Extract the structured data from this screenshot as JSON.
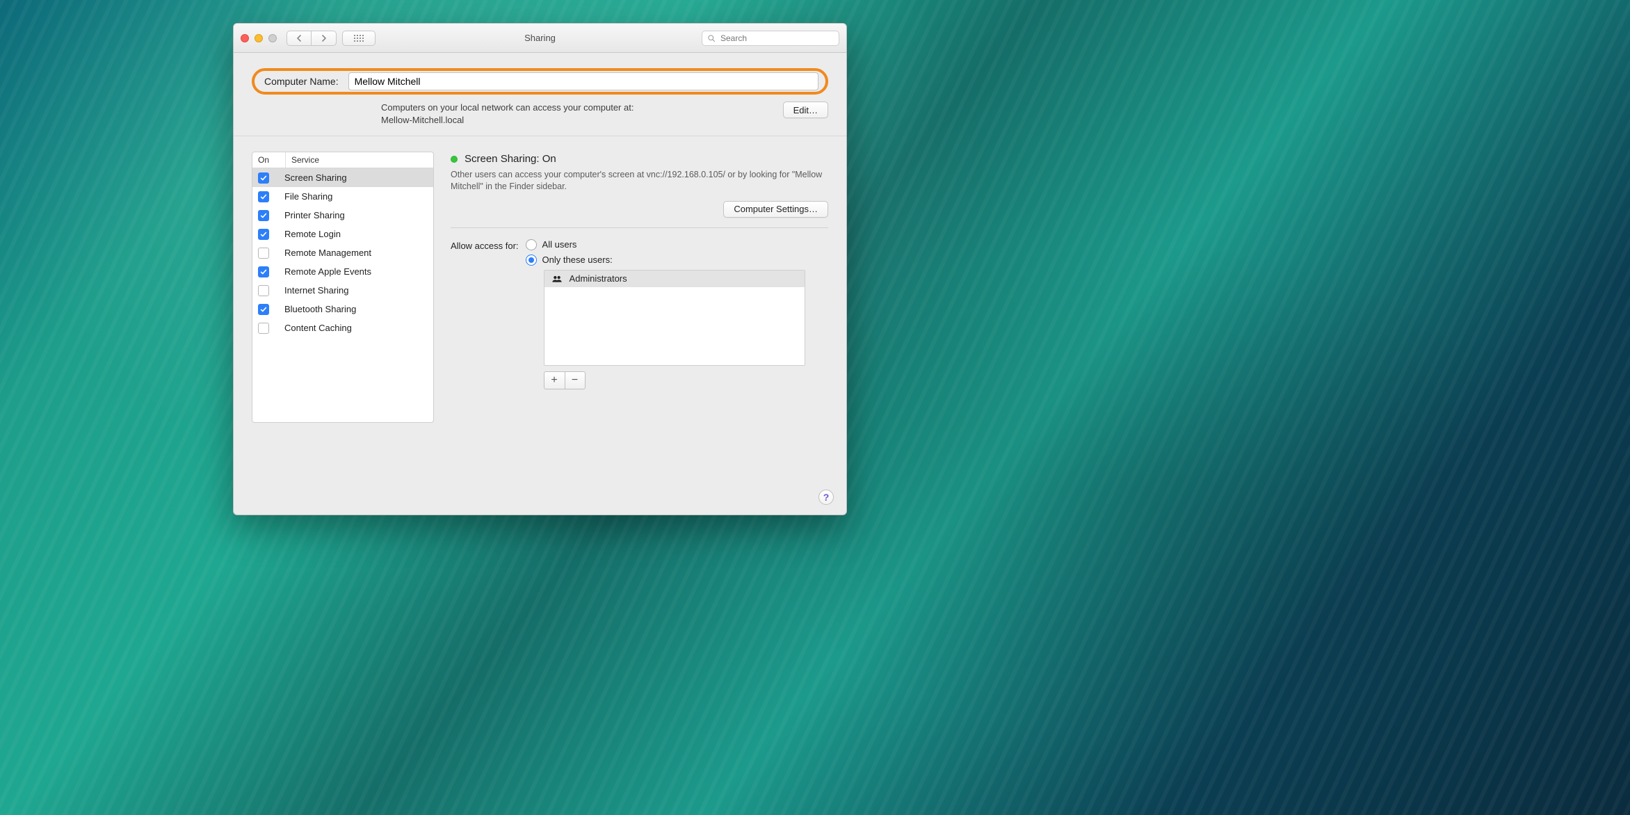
{
  "window": {
    "title": "Sharing",
    "search_placeholder": "Search"
  },
  "header": {
    "computer_name_label": "Computer Name:",
    "computer_name_value": "Mellow Mitchell",
    "network_text_line1": "Computers on your local network can access your computer at:",
    "network_text_line2": "Mellow-Mitchell.local",
    "edit_label": "Edit…"
  },
  "services": {
    "head_on": "On",
    "head_service": "Service",
    "items": [
      {
        "label": "Screen Sharing",
        "on": true,
        "selected": true
      },
      {
        "label": "File Sharing",
        "on": true,
        "selected": false
      },
      {
        "label": "Printer Sharing",
        "on": true,
        "selected": false
      },
      {
        "label": "Remote Login",
        "on": true,
        "selected": false
      },
      {
        "label": "Remote Management",
        "on": false,
        "selected": false
      },
      {
        "label": "Remote Apple Events",
        "on": true,
        "selected": false
      },
      {
        "label": "Internet Sharing",
        "on": false,
        "selected": false
      },
      {
        "label": "Bluetooth Sharing",
        "on": true,
        "selected": false
      },
      {
        "label": "Content Caching",
        "on": false,
        "selected": false
      }
    ]
  },
  "detail": {
    "status_title": "Screen Sharing: On",
    "description": "Other users can access your computer's screen at vnc://192.168.0.105/ or by looking for \"Mellow Mitchell\" in the Finder sidebar.",
    "computer_settings_label": "Computer Settings…",
    "access_label": "Allow access for:",
    "radio_all": "All users",
    "radio_only": "Only these users:",
    "selected_radio": "only",
    "users": [
      {
        "name": "Administrators"
      }
    ],
    "plus": "+",
    "minus": "−"
  },
  "help_label": "?"
}
